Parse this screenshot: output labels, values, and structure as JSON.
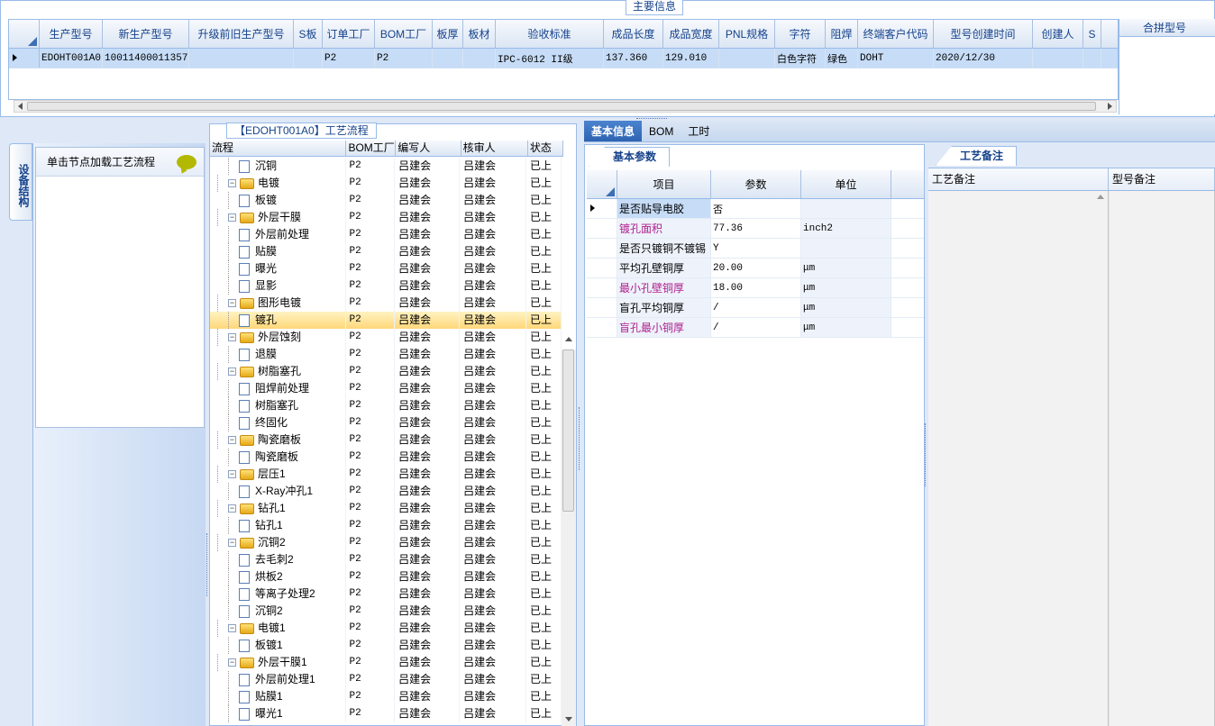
{
  "top": {
    "caption": "主要信息",
    "columns": [
      "生产型号",
      "新生产型号",
      "升级前旧生产型号",
      "S板",
      "订单工厂",
      "BOM工厂",
      "板厚",
      "板材",
      "验收标准",
      "成品长度",
      "成品宽度",
      "PNL规格",
      "字符",
      "阻焊",
      "终端客户代码",
      "型号创建时间",
      "创建人",
      "S"
    ],
    "row": [
      "EDOHT001A0",
      "10011400011357",
      "",
      "",
      "P2",
      "P2",
      "",
      "",
      "IPC-6012 II级",
      "137.360",
      "129.010",
      "",
      "白色字符",
      "绿色",
      "DOHT",
      "2020/12/30",
      "",
      ""
    ],
    "merge_header": "合拼型号"
  },
  "left": {
    "vtab_label": "设备结构",
    "node_hint": "单击节点加载工艺流程"
  },
  "flow": {
    "caption": "【EDOHT001A0】工艺流程",
    "headers": [
      "流程",
      "BOM工厂",
      "编写人",
      "核审人",
      "状态"
    ],
    "rows": [
      {
        "level": 2,
        "type": "doc",
        "name": "沉铜",
        "bom": "P2",
        "writer": "吕建会",
        "reviewer": "吕建会",
        "status": "已上"
      },
      {
        "level": 1,
        "type": "folder",
        "name": "电镀",
        "bom": "P2",
        "writer": "吕建会",
        "reviewer": "吕建会",
        "status": "已上"
      },
      {
        "level": 2,
        "type": "doc",
        "name": "板镀",
        "bom": "P2",
        "writer": "吕建会",
        "reviewer": "吕建会",
        "status": "已上"
      },
      {
        "level": 1,
        "type": "folder",
        "name": "外层干膜",
        "bom": "P2",
        "writer": "吕建会",
        "reviewer": "吕建会",
        "status": "已上"
      },
      {
        "level": 2,
        "type": "doc",
        "name": "外层前处理",
        "bom": "P2",
        "writer": "吕建会",
        "reviewer": "吕建会",
        "status": "已上"
      },
      {
        "level": 2,
        "type": "doc",
        "name": "贴膜",
        "bom": "P2",
        "writer": "吕建会",
        "reviewer": "吕建会",
        "status": "已上"
      },
      {
        "level": 2,
        "type": "doc",
        "name": "曝光",
        "bom": "P2",
        "writer": "吕建会",
        "reviewer": "吕建会",
        "status": "已上"
      },
      {
        "level": 2,
        "type": "doc",
        "name": "显影",
        "bom": "P2",
        "writer": "吕建会",
        "reviewer": "吕建会",
        "status": "已上"
      },
      {
        "level": 1,
        "type": "folder",
        "name": "图形电镀",
        "bom": "P2",
        "writer": "吕建会",
        "reviewer": "吕建会",
        "status": "已上"
      },
      {
        "level": 2,
        "type": "doc",
        "name": "镀孔",
        "bom": "P2",
        "writer": "吕建会",
        "reviewer": "吕建会",
        "status": "已上",
        "selected": true
      },
      {
        "level": 1,
        "type": "folder",
        "name": "外层蚀刻",
        "bom": "P2",
        "writer": "吕建会",
        "reviewer": "吕建会",
        "status": "已上"
      },
      {
        "level": 2,
        "type": "doc",
        "name": "退膜",
        "bom": "P2",
        "writer": "吕建会",
        "reviewer": "吕建会",
        "status": "已上"
      },
      {
        "level": 1,
        "type": "folder",
        "name": "树脂塞孔",
        "bom": "P2",
        "writer": "吕建会",
        "reviewer": "吕建会",
        "status": "已上"
      },
      {
        "level": 2,
        "type": "doc",
        "name": "阻焊前处理",
        "bom": "P2",
        "writer": "吕建会",
        "reviewer": "吕建会",
        "status": "已上"
      },
      {
        "level": 2,
        "type": "doc",
        "name": "树脂塞孔",
        "bom": "P2",
        "writer": "吕建会",
        "reviewer": "吕建会",
        "status": "已上"
      },
      {
        "level": 2,
        "type": "doc",
        "name": "终固化",
        "bom": "P2",
        "writer": "吕建会",
        "reviewer": "吕建会",
        "status": "已上"
      },
      {
        "level": 1,
        "type": "folder",
        "name": "陶瓷磨板",
        "bom": "P2",
        "writer": "吕建会",
        "reviewer": "吕建会",
        "status": "已上"
      },
      {
        "level": 2,
        "type": "doc",
        "name": "陶瓷磨板",
        "bom": "P2",
        "writer": "吕建会",
        "reviewer": "吕建会",
        "status": "已上"
      },
      {
        "level": 1,
        "type": "folder",
        "name": "层压1",
        "bom": "P2",
        "writer": "吕建会",
        "reviewer": "吕建会",
        "status": "已上"
      },
      {
        "level": 2,
        "type": "doc",
        "name": "X-Ray冲孔1",
        "bom": "P2",
        "writer": "吕建会",
        "reviewer": "吕建会",
        "status": "已上"
      },
      {
        "level": 1,
        "type": "folder",
        "name": "钻孔1",
        "bom": "P2",
        "writer": "吕建会",
        "reviewer": "吕建会",
        "status": "已上"
      },
      {
        "level": 2,
        "type": "doc",
        "name": "钻孔1",
        "bom": "P2",
        "writer": "吕建会",
        "reviewer": "吕建会",
        "status": "已上"
      },
      {
        "level": 1,
        "type": "folder",
        "name": "沉铜2",
        "bom": "P2",
        "writer": "吕建会",
        "reviewer": "吕建会",
        "status": "已上"
      },
      {
        "level": 2,
        "type": "doc",
        "name": "去毛刺2",
        "bom": "P2",
        "writer": "吕建会",
        "reviewer": "吕建会",
        "status": "已上"
      },
      {
        "level": 2,
        "type": "doc",
        "name": "烘板2",
        "bom": "P2",
        "writer": "吕建会",
        "reviewer": "吕建会",
        "status": "已上"
      },
      {
        "level": 2,
        "type": "doc",
        "name": "等离子处理2",
        "bom": "P2",
        "writer": "吕建会",
        "reviewer": "吕建会",
        "status": "已上"
      },
      {
        "level": 2,
        "type": "doc",
        "name": "沉铜2",
        "bom": "P2",
        "writer": "吕建会",
        "reviewer": "吕建会",
        "status": "已上"
      },
      {
        "level": 1,
        "type": "folder",
        "name": "电镀1",
        "bom": "P2",
        "writer": "吕建会",
        "reviewer": "吕建会",
        "status": "已上"
      },
      {
        "level": 2,
        "type": "doc",
        "name": "板镀1",
        "bom": "P2",
        "writer": "吕建会",
        "reviewer": "吕建会",
        "status": "已上"
      },
      {
        "level": 1,
        "type": "folder",
        "name": "外层干膜1",
        "bom": "P2",
        "writer": "吕建会",
        "reviewer": "吕建会",
        "status": "已上"
      },
      {
        "level": 2,
        "type": "doc",
        "name": "外层前处理1",
        "bom": "P2",
        "writer": "吕建会",
        "reviewer": "吕建会",
        "status": "已上"
      },
      {
        "level": 2,
        "type": "doc",
        "name": "贴膜1",
        "bom": "P2",
        "writer": "吕建会",
        "reviewer": "吕建会",
        "status": "已上"
      },
      {
        "level": 2,
        "type": "doc",
        "name": "曝光1",
        "bom": "P2",
        "writer": "吕建会",
        "reviewer": "吕建会",
        "status": "已上"
      }
    ]
  },
  "tabs": [
    "基本信息",
    "BOM",
    "工时"
  ],
  "basic": {
    "tab_label": "基本参数",
    "headers": [
      "项目",
      "参数",
      "单位"
    ],
    "rows": [
      {
        "item": "是否贴导电胶",
        "value": "否",
        "unit": "",
        "pink": false,
        "selected": true
      },
      {
        "item": "镀孔面积",
        "value": "77.36",
        "unit": "inch2",
        "pink": true
      },
      {
        "item": "是否只镀铜不镀锡",
        "value": "Y",
        "unit": "",
        "pink": false
      },
      {
        "item": "平均孔壁铜厚",
        "value": "20.00",
        "unit": "μm",
        "pink": false
      },
      {
        "item": "最小孔壁铜厚",
        "value": "18.00",
        "unit": "μm",
        "pink": true
      },
      {
        "item": "盲孔平均铜厚",
        "value": "/",
        "unit": "μm",
        "pink": false
      },
      {
        "item": "盲孔最小铜厚",
        "value": "/",
        "unit": "μm",
        "pink": true
      }
    ]
  },
  "remarks": {
    "tab_label": "工艺备注",
    "col1": "工艺备注",
    "col2": "型号备注"
  }
}
